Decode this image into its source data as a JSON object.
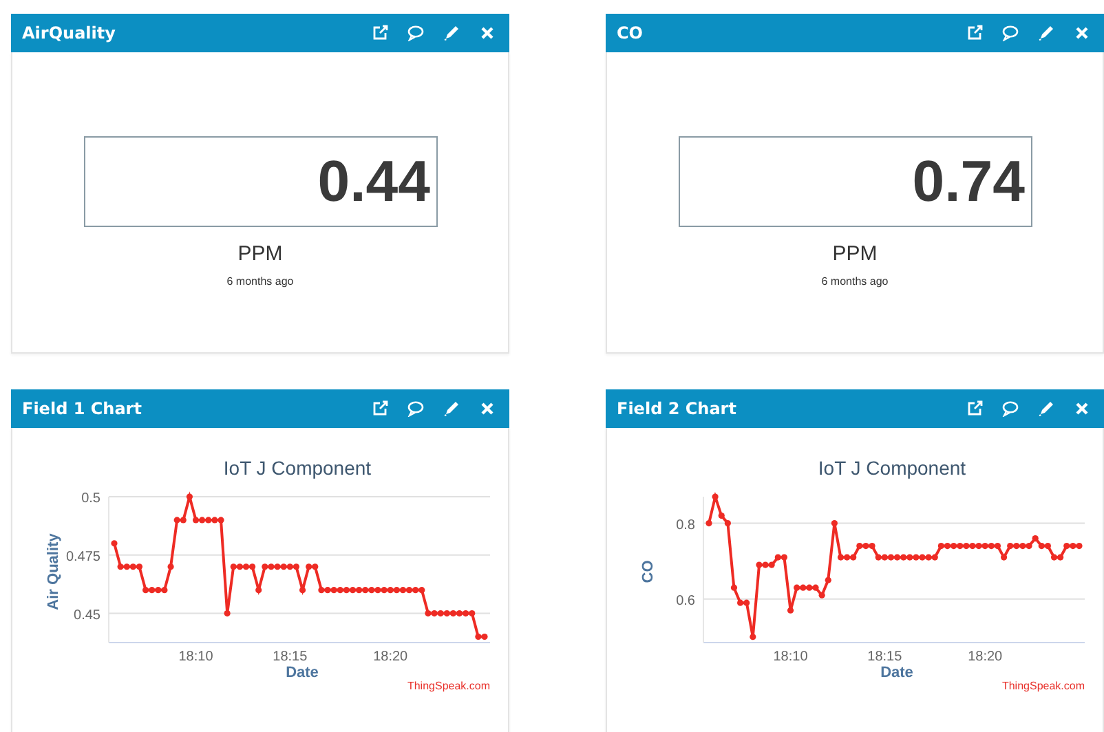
{
  "widgets": [
    {
      "kind": "numeric",
      "title": "AirQuality",
      "value": "0.44",
      "unit": "PPM",
      "updated": "6 months ago"
    },
    {
      "kind": "numeric",
      "title": "CO",
      "value": "0.74",
      "unit": "PPM",
      "updated": "6 months ago"
    },
    {
      "kind": "chart",
      "title": "Field 1 Chart",
      "credit": "ThingSpeak.com",
      "chart_data": {
        "type": "line",
        "title": "IoT J Component",
        "xlabel": "Date",
        "ylabel": "Air Quality",
        "categories": [
          null,
          null,
          null,
          null,
          null,
          null,
          null,
          null,
          null,
          null,
          null,
          null,
          null,
          "18:10",
          null,
          null,
          null,
          null,
          null,
          null,
          null,
          null,
          null,
          null,
          null,
          null,
          null,
          null,
          "18:15",
          null,
          null,
          null,
          null,
          null,
          null,
          null,
          null,
          null,
          null,
          null,
          null,
          null,
          null,
          null,
          "18:20",
          null,
          null,
          null,
          null,
          null,
          null,
          null,
          null,
          null,
          null,
          null,
          null,
          null,
          null,
          null
        ],
        "series": [
          {
            "color": "#ee2b24",
            "marker": "circle",
            "values": [
              0.48,
              0.47,
              0.47,
              0.47,
              0.47,
              0.46,
              0.46,
              0.46,
              0.46,
              0.47,
              0.49,
              0.49,
              0.5,
              0.49,
              0.49,
              0.49,
              0.49,
              0.49,
              0.45,
              0.47,
              0.47,
              0.47,
              0.47,
              0.46,
              0.47,
              0.47,
              0.47,
              0.47,
              0.47,
              0.47,
              0.46,
              0.47,
              0.47,
              0.46,
              0.46,
              0.46,
              0.46,
              0.46,
              0.46,
              0.46,
              0.46,
              0.46,
              0.46,
              0.46,
              0.46,
              0.46,
              0.46,
              0.46,
              0.46,
              0.46,
              0.45,
              0.45,
              0.45,
              0.45,
              0.45,
              0.45,
              0.45,
              0.45,
              0.44,
              0.44
            ]
          }
        ],
        "grid": true,
        "ylim": [
          0.4375,
          0.5
        ],
        "yticks": [
          0.45,
          0.475,
          0.5
        ]
      }
    },
    {
      "kind": "chart",
      "title": "Field 2 Chart",
      "credit": "ThingSpeak.com",
      "chart_data": {
        "type": "line",
        "title": "IoT J Component",
        "xlabel": "Date",
        "ylabel": "CO",
        "categories": [
          null,
          null,
          null,
          null,
          null,
          null,
          null,
          null,
          null,
          null,
          null,
          null,
          null,
          "18:10",
          null,
          null,
          null,
          null,
          null,
          null,
          null,
          null,
          null,
          null,
          null,
          null,
          null,
          null,
          "18:15",
          null,
          null,
          null,
          null,
          null,
          null,
          null,
          null,
          null,
          null,
          null,
          null,
          null,
          null,
          null,
          "18:20",
          null,
          null,
          null,
          null,
          null,
          null,
          null,
          null,
          null,
          null,
          null,
          null,
          null,
          null,
          null
        ],
        "series": [
          {
            "color": "#ee2b24",
            "marker": "circle",
            "values": [
              0.8,
              0.87,
              0.82,
              0.8,
              0.63,
              0.59,
              0.59,
              0.5,
              0.69,
              0.69,
              0.69,
              0.71,
              0.71,
              0.57,
              0.63,
              0.63,
              0.63,
              0.63,
              0.61,
              0.65,
              0.8,
              0.71,
              0.71,
              0.71,
              0.74,
              0.74,
              0.74,
              0.71,
              0.71,
              0.71,
              0.71,
              0.71,
              0.71,
              0.71,
              0.71,
              0.71,
              0.71,
              0.74,
              0.74,
              0.74,
              0.74,
              0.74,
              0.74,
              0.74,
              0.74,
              0.74,
              0.74,
              0.71,
              0.74,
              0.74,
              0.74,
              0.74,
              0.76,
              0.74,
              0.74,
              0.71,
              0.71,
              0.74,
              0.74,
              0.74
            ]
          }
        ],
        "grid": true,
        "ylim": [
          0.485,
          0.87
        ],
        "yticks": [
          0.6,
          0.8
        ]
      }
    }
  ]
}
